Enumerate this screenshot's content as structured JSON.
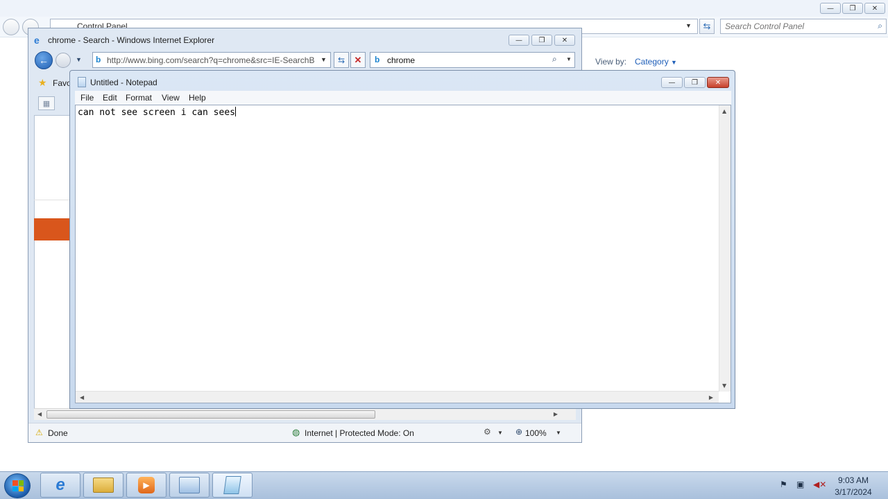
{
  "control_panel": {
    "breadcrumb": "Control Panel",
    "search_placeholder": "Search Control Panel",
    "view_by_label": "View by:",
    "view_by_value": "Category"
  },
  "ie": {
    "title": "chrome - Search - Windows Internet Explorer",
    "address": "http://www.bing.com/search?q=chrome&src=IE-SearchB",
    "search_value": "chrome",
    "favorites_label": "Favo",
    "status_text": "Done",
    "zone_text": "Internet | Protected Mode: On",
    "zoom": "100%"
  },
  "notepad": {
    "title": "Untitled - Notepad",
    "menu": [
      "File",
      "Edit",
      "Format",
      "View",
      "Help"
    ],
    "content": "can not see screen i can sees"
  },
  "taskbar": {
    "time": "9:03 AM",
    "date": "3/17/2024",
    "buttons": [
      "internet-explorer",
      "windows-explorer",
      "media-player",
      "control-panel",
      "notepad"
    ]
  }
}
